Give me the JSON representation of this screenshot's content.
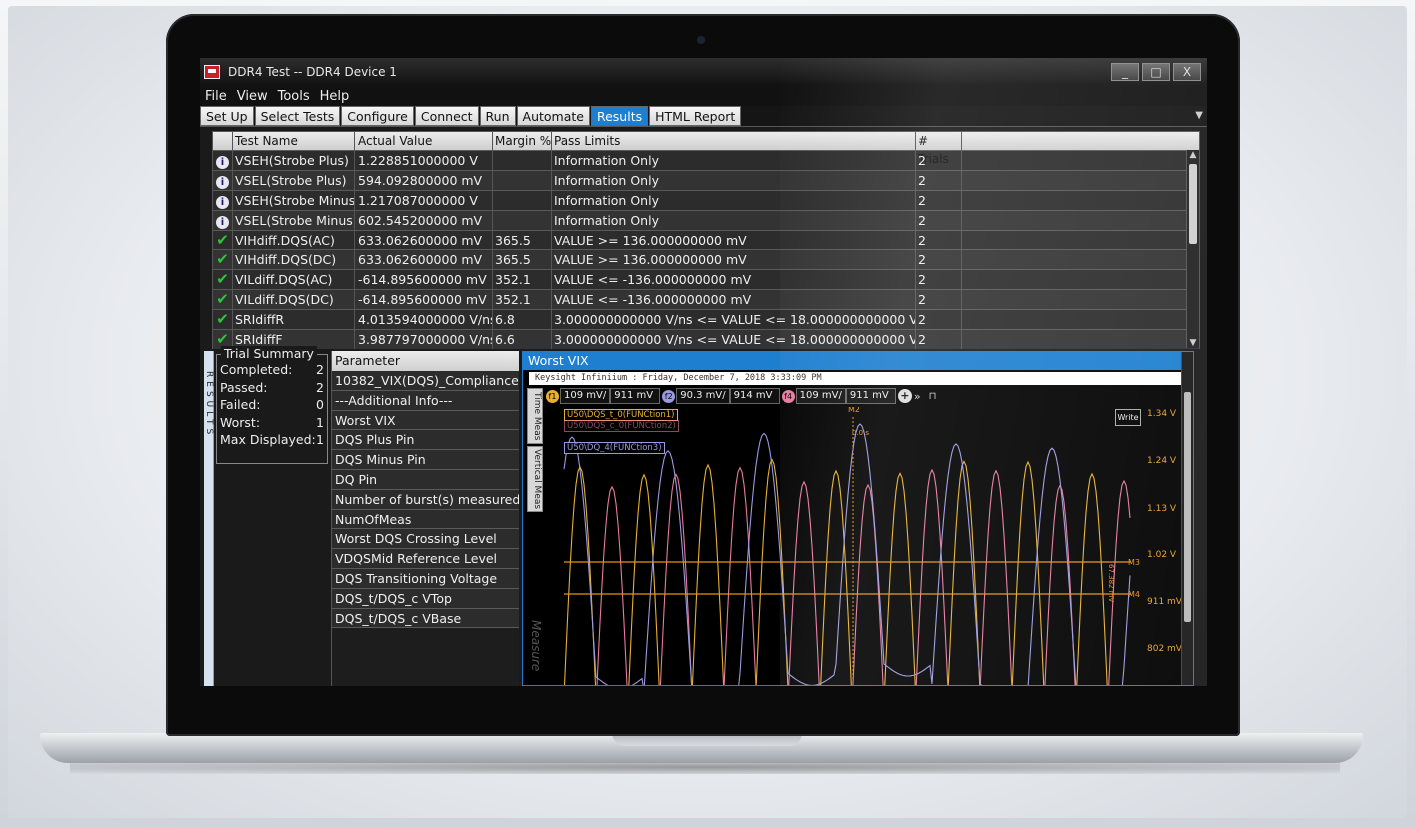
{
  "window": {
    "title": "DDR4 Test -- DDR4 Device 1",
    "min": "_",
    "max": "□",
    "close": "X"
  },
  "menu": [
    "File",
    "View",
    "Tools",
    "Help"
  ],
  "tabs": [
    {
      "label": "Set Up",
      "active": false
    },
    {
      "label": "Select Tests",
      "active": false
    },
    {
      "label": "Configure",
      "active": false
    },
    {
      "label": "Connect",
      "active": false
    },
    {
      "label": "Run",
      "active": false
    },
    {
      "label": "Automate",
      "active": false
    },
    {
      "label": "Results",
      "active": true
    },
    {
      "label": "HTML Report",
      "active": false
    }
  ],
  "results": {
    "headers": {
      "name": "Test Name",
      "value": "Actual Value",
      "margin": "Margin %",
      "limits": "Pass Limits",
      "trials": "# Trials"
    },
    "rows": [
      {
        "status": "info",
        "name": "VSEH(Strobe Plus)",
        "value": "1.228851000000 V",
        "margin": "",
        "limits": "Information Only",
        "trials": "2"
      },
      {
        "status": "info",
        "name": "VSEL(Strobe Plus)",
        "value": "594.092800000 mV",
        "margin": "",
        "limits": "Information Only",
        "trials": "2"
      },
      {
        "status": "info",
        "name": "VSEH(Strobe Minus)",
        "value": "1.217087000000 V",
        "margin": "",
        "limits": "Information Only",
        "trials": "2"
      },
      {
        "status": "info",
        "name": "VSEL(Strobe Minus)",
        "value": "602.545200000 mV",
        "margin": "",
        "limits": "Information Only",
        "trials": "2"
      },
      {
        "status": "pass",
        "name": "VIHdiff.DQS(AC)",
        "value": "633.062600000 mV",
        "margin": "365.5",
        "limits": "VALUE >= 136.000000000 mV",
        "trials": "2"
      },
      {
        "status": "pass",
        "name": "VIHdiff.DQS(DC)",
        "value": "633.062600000 mV",
        "margin": "365.5",
        "limits": "VALUE >= 136.000000000 mV",
        "trials": "2"
      },
      {
        "status": "pass",
        "name": "VILdiff.DQS(AC)",
        "value": "-614.895600000 mV",
        "margin": "352.1",
        "limits": "VALUE <= -136.000000000 mV",
        "trials": "2"
      },
      {
        "status": "pass",
        "name": "VILdiff.DQS(DC)",
        "value": "-614.895600000 mV",
        "margin": "352.1",
        "limits": "VALUE <= -136.000000000 mV",
        "trials": "2"
      },
      {
        "status": "pass",
        "name": "SRIdiffR",
        "value": "4.013594000000 V/ns",
        "margin": "6.8",
        "limits": "3.000000000000 V/ns <= VALUE <= 18.000000000000 V/ns",
        "trials": "2"
      },
      {
        "status": "pass",
        "name": "SRIdiffF",
        "value": "3.987797000000 V/ns",
        "margin": "6.6",
        "limits": "3.000000000000 V/ns <= VALUE <= 18.000000000000 V/ns",
        "trials": "2"
      }
    ]
  },
  "side_rail": "RESULTS",
  "trial_summary": {
    "title": "Trial Summary",
    "rows": [
      {
        "label": "Completed:",
        "value": "2"
      },
      {
        "label": "Passed:",
        "value": "2"
      },
      {
        "label": "Failed:",
        "value": "0"
      },
      {
        "label": "Worst:",
        "value": "1"
      },
      {
        "label": "Max Displayed:",
        "value": "1"
      }
    ]
  },
  "parameters": {
    "header": "Parameter",
    "rows": [
      "10382_VIX(DQS)_Compliance",
      "---Additional Info---",
      "Worst VIX",
      "DQS Plus Pin",
      "DQS Minus Pin",
      "DQ Pin",
      "Number of burst(s) measured",
      "NumOfMeas",
      "Worst DQS Crossing Level",
      "VDQSMid Reference Level",
      "DQS Transitioning Voltage",
      "DQS_t/DQS_c VTop",
      "DQS_t/DQS_c VBase"
    ]
  },
  "graph": {
    "title": "Worst VIX",
    "subtitle": "Keysight Infiniium : Friday, December 7, 2018 3:33:09 PM",
    "side_tabs": [
      "Time Meas",
      "Vertical Meas"
    ],
    "side_watermark": "Measure",
    "measurements": [
      {
        "id": "f1",
        "color": "#e8b030",
        "a": "109 mV/",
        "b": "911 mV"
      },
      {
        "id": "f2",
        "color": "#9a9ae0",
        "a": "90.3 mV/",
        "b": "914 mV"
      },
      {
        "id": "f4",
        "color": "#e87aa0",
        "a": "109 mV/",
        "b": "911 mV"
      }
    ],
    "write_label": "Write",
    "marker_m2": "M2",
    "marker_m2_time": "0.0 s",
    "marker_m3": "M3",
    "marker_m4": "M4",
    "marker_delta": "67.382 mV",
    "y_labels": [
      "1.34 V",
      "1.24 V",
      "1.13 V",
      "1.02 V",
      "911 mV",
      "802 mV"
    ],
    "channels": [
      {
        "label": "U50\\DQS_t_0(FUNCtion1)",
        "color": "#e8b030"
      },
      {
        "label": "U50\\DQS_c_0(FUNCtion2)",
        "color": "#e87aa0"
      },
      {
        "label": "U50\\DQ_4(FUNCtion3)",
        "color": "#9a9ae0"
      }
    ],
    "colors": {
      "dqs_t": "#e8b030",
      "dqs_c": "#e87aa0",
      "dq": "#9a9ae0",
      "marker": "#e8901a"
    }
  }
}
